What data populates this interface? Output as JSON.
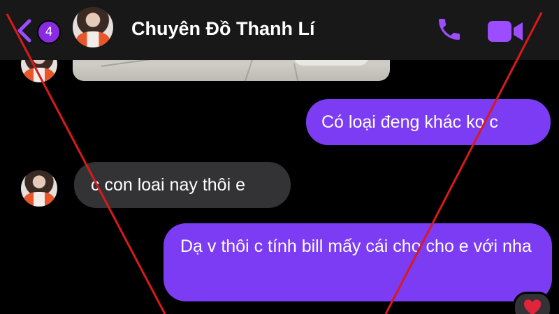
{
  "header": {
    "unread_count": "4",
    "contact_name": "Chuyên Đồ Thanh Lí",
    "avatar_icon": "contact-avatar",
    "back_icon": "chevron-left-icon",
    "call_icon": "phone-icon",
    "video_icon": "video-camera-icon"
  },
  "messages": [
    {
      "direction": "outgoing",
      "text": "Có loại đeng khác ko c"
    },
    {
      "direction": "incoming",
      "text": "c con loai nay thôi e"
    },
    {
      "direction": "outgoing",
      "text": "Dạ v thôi c tính bill mấy cái cho cho e với nha"
    }
  ],
  "reaction": {
    "emoji": "heart",
    "target": "message-3"
  },
  "colors": {
    "accent": "#8a2be2",
    "outgoing_bubble": "#7c3cf3",
    "incoming_bubble": "#333336",
    "background": "#000000",
    "header": "#181818",
    "watermark_cross": "#d91a1a",
    "heart": "#e0243a"
  }
}
